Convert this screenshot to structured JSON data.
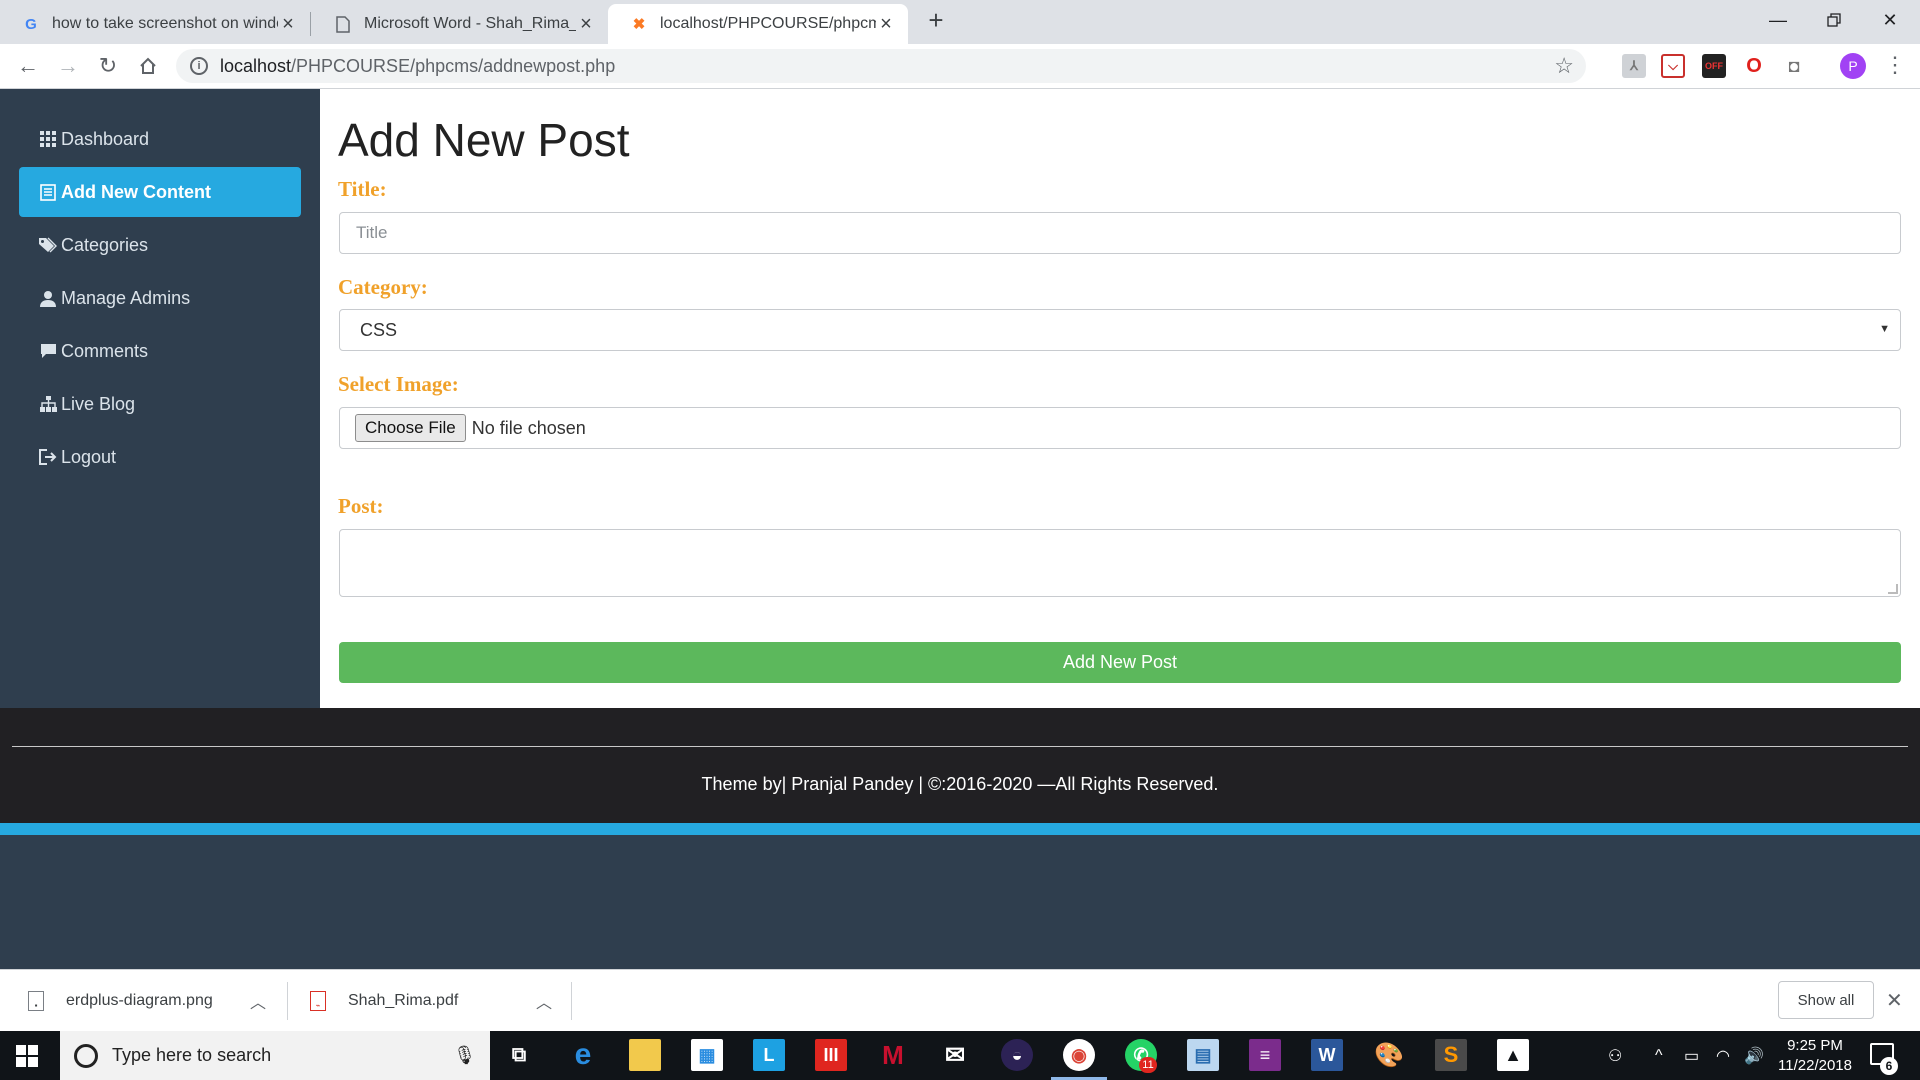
{
  "browser": {
    "tabs": [
      {
        "title": "how to take screenshot on windo",
        "icon": "google-icon"
      },
      {
        "title": "Microsoft Word - Shah_Rima_onc",
        "icon": "document-icon"
      },
      {
        "title": "localhost/PHPCOURSE/phpcms/a",
        "icon": "xampp-icon",
        "active": true
      }
    ],
    "url_host": "localhost",
    "url_path": "/PHPCOURSE/phpcms/addnewpost.php"
  },
  "sidebar": {
    "items": [
      {
        "label": "Dashboard",
        "icon": "grid-icon"
      },
      {
        "label": "Add New Content",
        "icon": "list-icon",
        "active": true
      },
      {
        "label": "Categories",
        "icon": "tags-icon"
      },
      {
        "label": "Manage Admins",
        "icon": "user-icon"
      },
      {
        "label": "Comments",
        "icon": "comment-icon"
      },
      {
        "label": "Live Blog",
        "icon": "sitemap-icon"
      },
      {
        "label": "Logout",
        "icon": "logout-icon"
      }
    ]
  },
  "main": {
    "heading": "Add New Post",
    "title_label": "Title:",
    "title_placeholder": "Title",
    "category_label": "Category:",
    "category_selected": "CSS",
    "image_label": "Select Image:",
    "choose_file": "Choose File",
    "no_file": "No file chosen",
    "post_label": "Post:",
    "submit_label": "Add New Post"
  },
  "footer": {
    "text": "Theme by| Pranjal Pandey | ©:2016-2020 —All Rights Reserved."
  },
  "downloads": {
    "items": [
      {
        "name": "erdplus-diagram.png"
      },
      {
        "name": "Shah_Rima.pdf"
      }
    ],
    "show_all": "Show all"
  },
  "taskbar": {
    "search_placeholder": "Type here to search",
    "time": "9:25 PM",
    "date": "11/22/2018",
    "notification_count": "6",
    "whatsapp_badge": "11"
  },
  "colors": {
    "sidebar_bg": "#2f3e4e",
    "accent_blue": "#26a9e0",
    "label_orange": "#f0a12a",
    "submit_green": "#5cb85c",
    "footer_bg": "#212023"
  }
}
